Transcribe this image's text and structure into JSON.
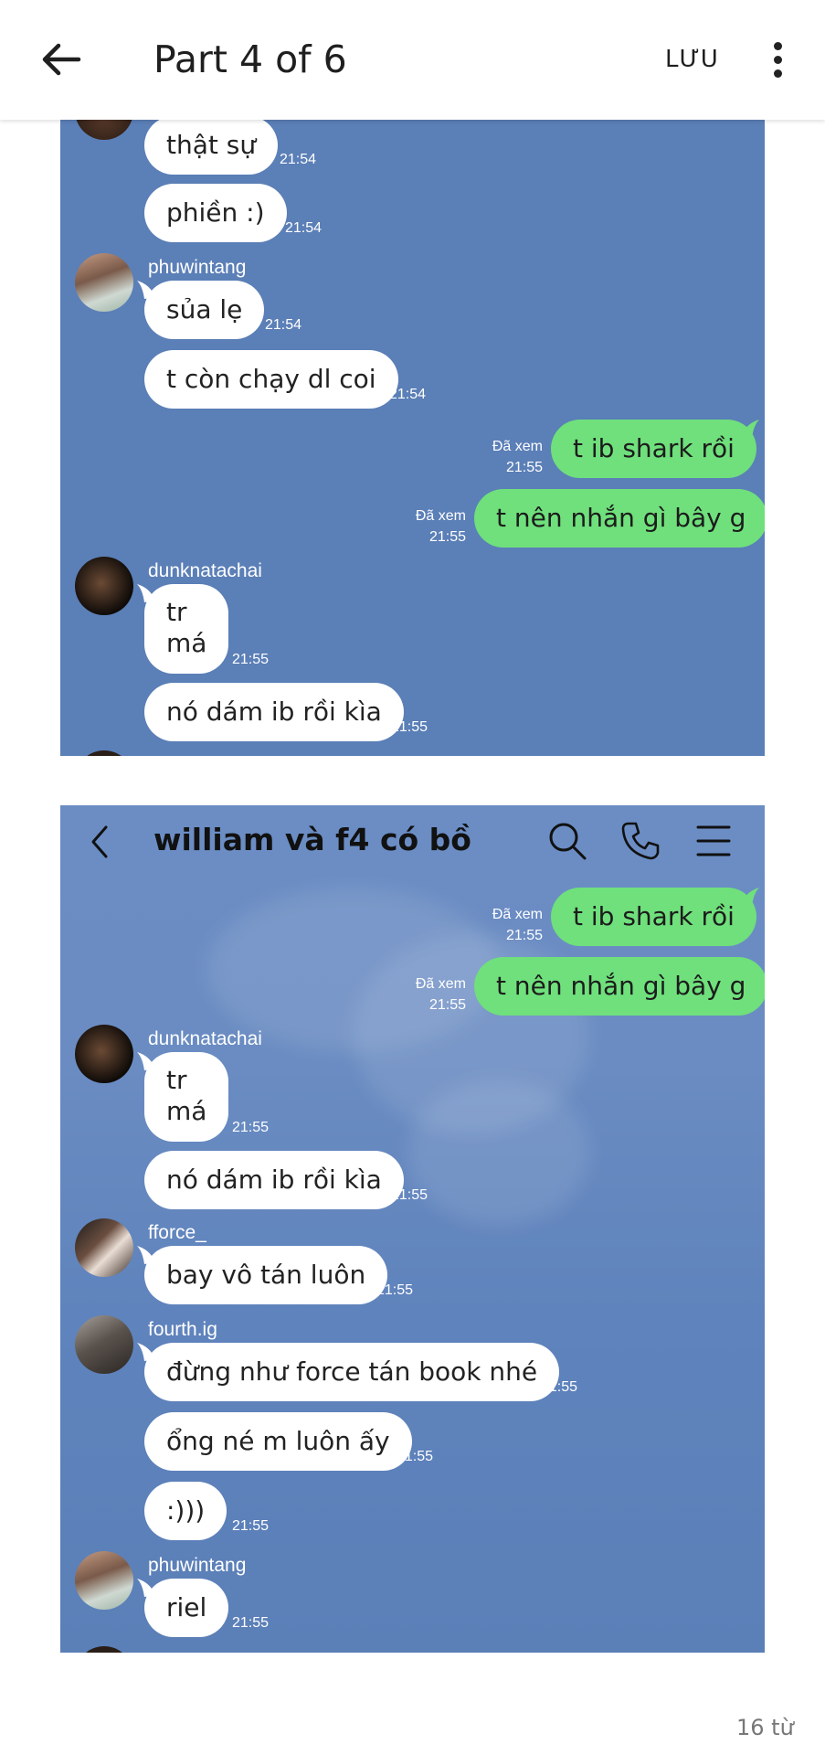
{
  "app_bar": {
    "title": "Part 4 of 6",
    "save_label": "LƯU"
  },
  "shot1": {
    "messages": [
      {
        "text": "thật sự",
        "time": "21:54"
      },
      {
        "text": "phiền :)",
        "time": "21:54"
      },
      {
        "sender": "phuwintang",
        "text": "sủa lẹ",
        "time": "21:54"
      },
      {
        "text": "t còn chạy dl coi",
        "time": "21:54"
      },
      {
        "seen": "Đã xem",
        "text": "t ib shark rồi",
        "time": "21:55"
      },
      {
        "seen": "Đã xem",
        "text": "t nên nhắn gì bây g",
        "time": "21:55"
      },
      {
        "sender": "dunknatachai",
        "line1": "tr",
        "line2": "má",
        "time": "21:55"
      },
      {
        "text": "nó dám ib rồi kìa",
        "time": "21:55"
      }
    ]
  },
  "shot2": {
    "chat_title": "william và f4 có bồ",
    "messages": [
      {
        "seen": "Đã xem",
        "text": "t ib shark rồi",
        "time": "21:55"
      },
      {
        "seen": "Đã xem",
        "text": "t nên nhắn gì bây g",
        "time": "21:55"
      },
      {
        "sender": "dunknatachai",
        "line1": "tr",
        "line2": "má",
        "time": "21:55"
      },
      {
        "text": "nó dám ib rồi kìa",
        "time": "21:55"
      },
      {
        "sender": "fforce_",
        "text": "bay vô tán luôn",
        "time": "21:55"
      },
      {
        "sender": "fourth.ig",
        "text": "đừng như force tán book nhé",
        "time": "21:55"
      },
      {
        "text": "ổng né m luôn ấy",
        "time": "21:55"
      },
      {
        "text": ":)))",
        "time": "21:55"
      },
      {
        "sender": "phuwintang",
        "text": "riel",
        "time": "21:55"
      }
    ]
  },
  "footer": {
    "word_count": "16 từ"
  },
  "colors": {
    "chat_bg": "#5b7fb7",
    "sent_bubble": "#6fe07c",
    "received_bubble": "#ffffff"
  }
}
